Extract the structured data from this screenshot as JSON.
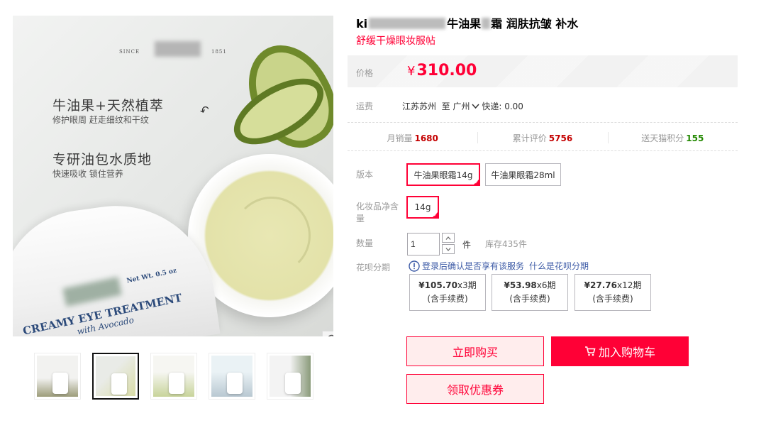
{
  "product": {
    "title_prefix": "ki",
    "title_main": "牛油果",
    "title_main_end": "霜 润肤抗皱 补水",
    "subtitle": "舒缓干燥眼妆服帖"
  },
  "main_image": {
    "since_left": "SINCE",
    "since_year": "1851",
    "headline_1": "牛油果+天然植萃",
    "sub_1": "修护眼周 赶走细纹和干纹",
    "headline_2": "专研油包水质地",
    "sub_2": "快速吸收 锁住营养",
    "jar_brand_line": "CREAMY EYE TREATMENT",
    "jar_sub_line": "with Avocado",
    "jar_net_wt": "Net Wt. 0.5 oz"
  },
  "price": {
    "label": "价格",
    "currency": "¥",
    "amount": "310.00"
  },
  "shipping": {
    "label": "运费",
    "origin": "江苏苏州",
    "to": "至",
    "destination": "广州",
    "express": "快递: 0.00"
  },
  "stats": {
    "monthly_sales_label": "月销量",
    "monthly_sales": "1680",
    "reviews_label": "累计评价",
    "reviews": "5756",
    "points_label": "送天猫积分",
    "points": "155"
  },
  "options": {
    "version_label": "版本",
    "version_items": [
      "牛油果眼霜14g",
      "牛油果眼霜28ml"
    ],
    "version_selected": 0,
    "net_label": "化妆品净含量",
    "net_items": [
      "14g"
    ],
    "net_selected": 0
  },
  "quantity": {
    "label": "数量",
    "value": "1",
    "unit": "件",
    "stock": "库存435件"
  },
  "huabei": {
    "label": "花呗分期",
    "login_text": "登录后确认是否享有该服务",
    "what_is_text": "什么是花呗分期",
    "plans": [
      {
        "amount": "¥105.70",
        "period": "x3期",
        "note": "(含手续费)"
      },
      {
        "amount": "¥53.98",
        "period": "x6期",
        "note": "(含手续费)"
      },
      {
        "amount": "¥27.76",
        "period": "x12期",
        "note": "(含手续费)"
      }
    ]
  },
  "buttons": {
    "buy_now": "立即购买",
    "add_to_cart": "加入购物车",
    "get_coupon": "领取优惠券"
  },
  "colors": {
    "accent": "#ff0036",
    "link": "#3c5aa6",
    "stat_red": "#c40000",
    "stat_green": "#228800"
  }
}
